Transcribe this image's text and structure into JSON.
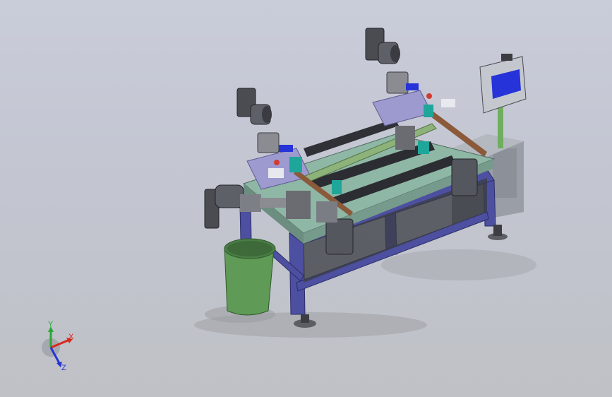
{
  "app": {
    "kind": "cad-3d-viewport"
  },
  "viewport": {
    "background_top": "#c9ccd9",
    "background_bottom": "#bfc1c6"
  },
  "colors": {
    "frame_blue": "#4d4fa0",
    "frame_blue_dark": "#34367a",
    "tabletop": "#8fb7a5",
    "bin_green": "#5f9a57",
    "motor_gray": "#4a4c52",
    "plate_lavender": "#9d9ad0",
    "rod_green": "#8db27a",
    "cabinet_gray": "#8c8f96",
    "accent_teal": "#1fa69a",
    "accent_red": "#d23b32"
  },
  "triad": {
    "x_label": "X",
    "y_label": "Y",
    "z_label": "Z",
    "x_color": "#d9261c",
    "y_color": "#2aa834",
    "z_color": "#2633d9"
  }
}
